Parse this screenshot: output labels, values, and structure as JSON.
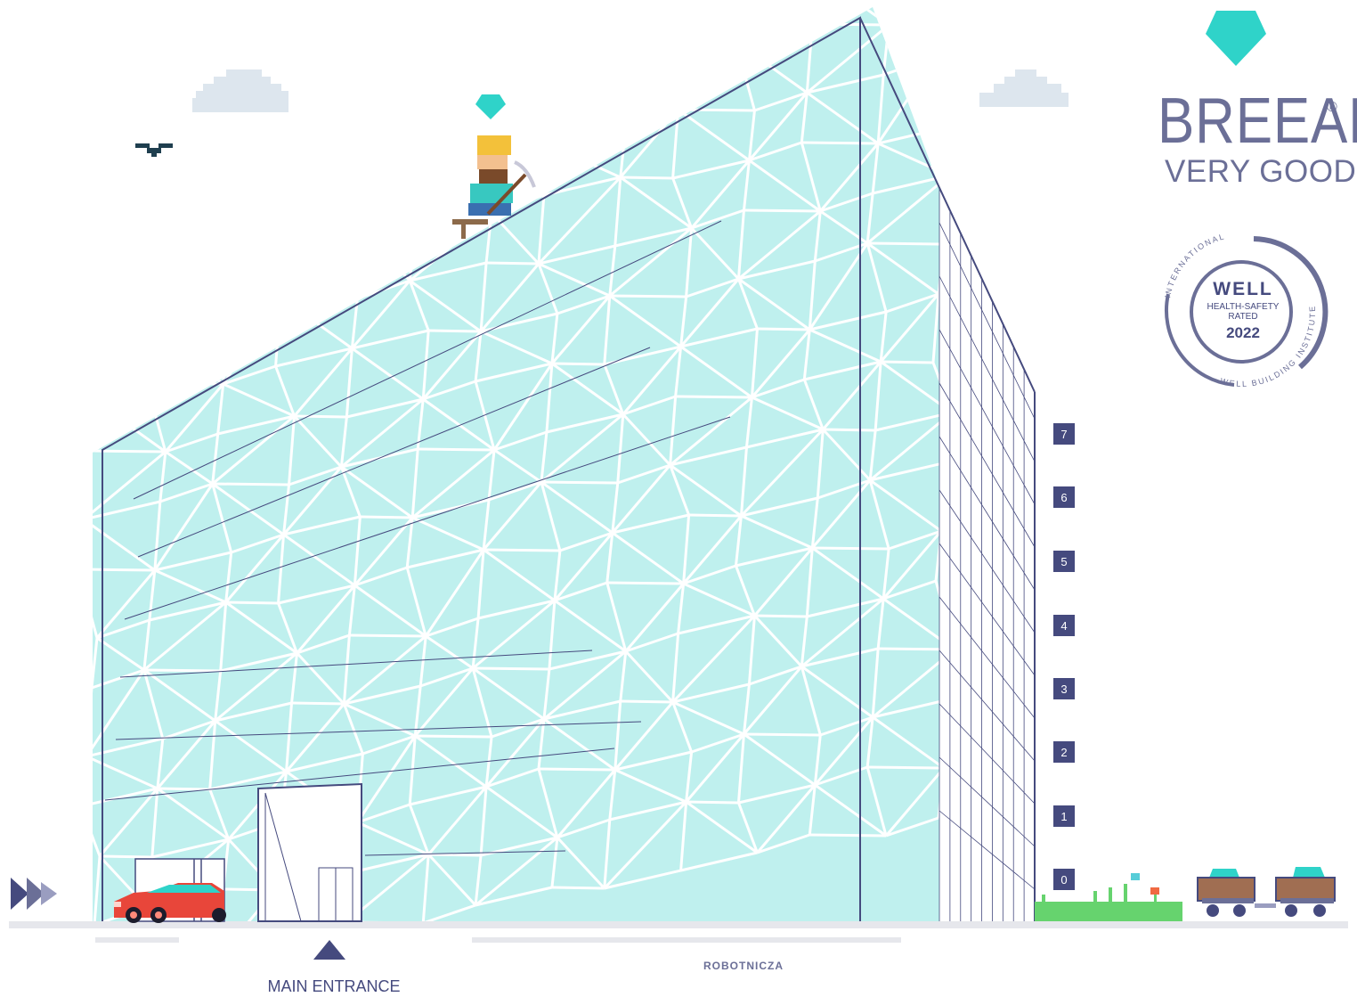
{
  "certifications": {
    "breeam": {
      "name": "BREEAM",
      "registered": "®",
      "rating": "VERY GOOD"
    },
    "well": {
      "title": "WELL",
      "line1": "HEALTH-SAFETY",
      "line2": "RATED",
      "year": "2022",
      "arc_top": "INTERNATIONAL",
      "arc_bottom": "WELL BUILDING INSTITUTE"
    }
  },
  "floors": [
    "7",
    "6",
    "5",
    "4",
    "3",
    "2",
    "1",
    "0"
  ],
  "labels": {
    "main_entrance": "MAIN ENTRANCE",
    "street": "ROBOTNICZA"
  },
  "icons": [
    "diamond-icon",
    "cloud-icon",
    "bird-icon",
    "miner-icon",
    "car-icon",
    "mine-cart-icon",
    "arrow-right-icon",
    "up-arrow-icon"
  ],
  "colors": {
    "facade": "#bff0ee",
    "outline": "#454a7e",
    "accent": "#2fd3c9",
    "car": "#e8463a",
    "cloud": "#dde6ee",
    "grass": "#66d36e"
  }
}
